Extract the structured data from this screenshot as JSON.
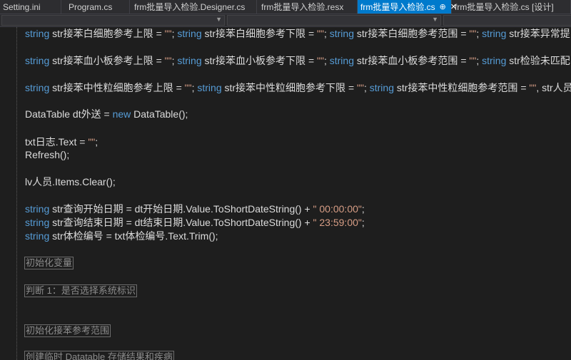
{
  "tabs": [
    {
      "label": "Setting.ini",
      "active": false
    },
    {
      "label": "Program.cs",
      "active": false
    },
    {
      "label": "frm批量导入检验.Designer.cs",
      "active": false
    },
    {
      "label": "frm批量导入检验.resx",
      "active": false
    },
    {
      "label": "frm批量导入检验.cs",
      "active": true,
      "pin": "⊕",
      "close": "✕"
    },
    {
      "label": "frm批量导入检验.cs [设计]",
      "active": false
    }
  ],
  "code": {
    "l1": {
      "kw1": "string",
      "t1": " str接苯白细胞参考上限 = ",
      "s1": "\"\"",
      "t2": "; ",
      "kw2": "string",
      "t3": " str接苯白细胞参考下限 = ",
      "s2": "\"\"",
      "t4": "; ",
      "kw3": "string",
      "t5": " str接苯白细胞参考范围 = ",
      "s3": "\"\"",
      "t6": "; ",
      "kw4": "string",
      "t7": " str接苯异常提"
    },
    "l2": {
      "kw1": "string",
      "t1": " str接苯血小板参考上限 = ",
      "s1": "\"\"",
      "t2": "; ",
      "kw2": "string",
      "t3": " str接苯血小板参考下限 = ",
      "s2": "\"\"",
      "t4": "; ",
      "kw3": "string",
      "t5": " str接苯血小板参考范围 = ",
      "s3": "\"\"",
      "t6": "; ",
      "kw4": "string",
      "t7": " str检验未匹配"
    },
    "l3": {
      "kw1": "string",
      "t1": " str接苯中性粒细胞参考上限 = ",
      "s1": "\"\"",
      "t2": "; ",
      "kw2": "string",
      "t3": " str接苯中性粒细胞参考下限 = ",
      "s2": "\"\"",
      "t4": "; ",
      "kw3": "string",
      "t5": " str接苯中性粒细胞参考范围 = ",
      "s3": "\"\"",
      "t6": ", str人员"
    },
    "l4": {
      "tp": "DataTable",
      "t1": " dt外送 = ",
      "kw": "new",
      "t2": " ",
      "tp2": "DataTable",
      "t3": "();"
    },
    "l5": {
      "t1": "txt日志.Text = ",
      "s1": "\"\"",
      "t2": ";"
    },
    "l6": {
      "t1": "Refresh();"
    },
    "l7": {
      "t1": "lv人员.Items.Clear();"
    },
    "l8": {
      "kw": "string",
      "t1": " str查询开始日期 = dt开始日期.Value.ToShortDateString() + ",
      "s1": "\" 00:00:00\"",
      "t2": ";"
    },
    "l9": {
      "kw": "string",
      "t1": " str查询结束日期 = dt结束日期.Value.ToShortDateString() + ",
      "s1": "\" 23:59:00\"",
      "t2": ";"
    },
    "l10": {
      "kw": "string",
      "t1": " str体检编号 = txt体检编号.Text.Trim();"
    },
    "r1": "初始化变量",
    "r2": "判断  1：是否选择系统标识",
    "r3": "初始化接苯参考范围",
    "r4": "创建临时 Datatable 存储结果和疾病"
  }
}
